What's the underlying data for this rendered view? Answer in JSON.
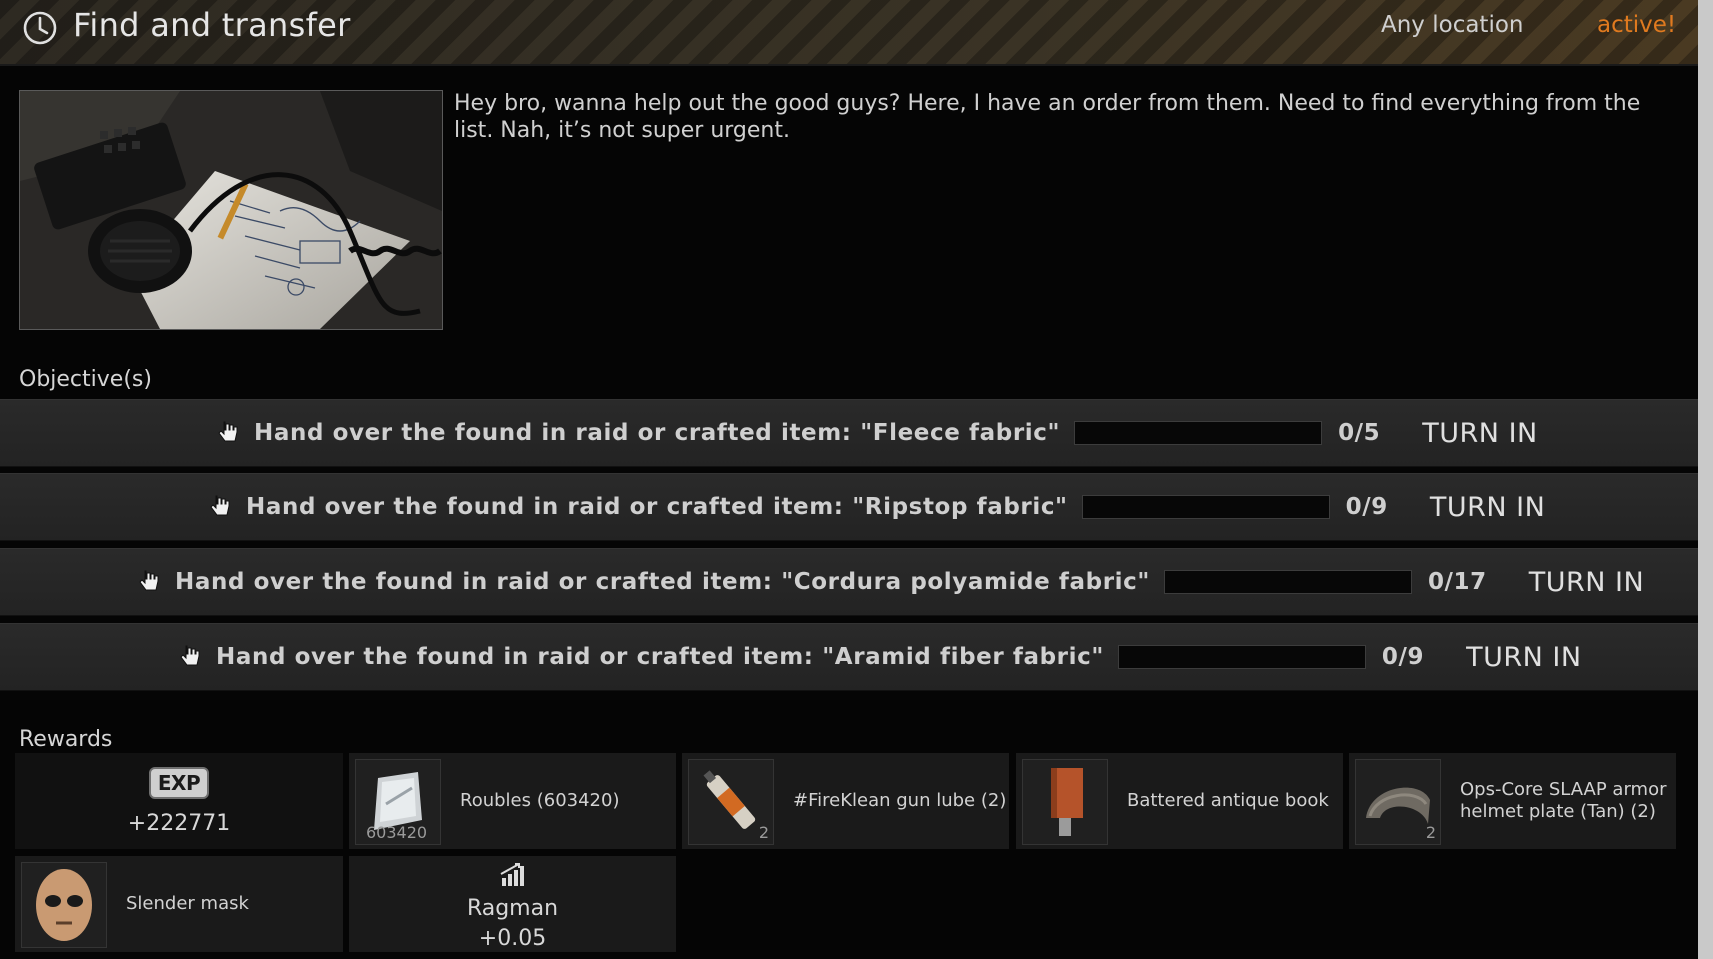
{
  "header": {
    "title": "Find and transfer",
    "location": "Any location",
    "status": "active!",
    "status_color": "#e07a1f",
    "icon": "clock-icon"
  },
  "briefing": {
    "description": "Hey bro, wanna help out the good guys? Here, I have an order from them. Need to find everything from the list. Nah, it’s not super urgent."
  },
  "objectives": {
    "label": "Objective(s)",
    "items": [
      {
        "text": "Hand over the found in raid or crafted item: \"Fleece fabric\"",
        "count": "0/5",
        "progress": 0,
        "button": "TURN IN"
      },
      {
        "text": "Hand over the found in raid or crafted item: \"Ripstop fabric\"",
        "count": "0/9",
        "progress": 0,
        "button": "TURN IN"
      },
      {
        "text": "Hand over the found in raid or crafted item: \"Cordura polyamide fabric\"",
        "count": "0/17",
        "progress": 0,
        "button": "TURN IN"
      },
      {
        "text": "Hand over the found in raid or crafted item: \"Aramid fiber fabric\"",
        "count": "0/9",
        "progress": 0,
        "button": "TURN IN"
      }
    ]
  },
  "rewards": {
    "label": "Rewards",
    "exp": {
      "badge": "EXP",
      "value": "+222771"
    },
    "items": [
      {
        "name": "Roubles (603420)",
        "stack": "603420",
        "icon": "roubles-icon"
      },
      {
        "name": "#FireKlean gun lube (2)",
        "stack": "2",
        "icon": "gun-lube-icon"
      },
      {
        "name": "Battered antique book",
        "stack": "",
        "icon": "book-icon"
      },
      {
        "name": "Ops-Core SLAAP armor helmet plate (Tan) (2)",
        "stack": "2",
        "icon": "helmet-plate-icon"
      },
      {
        "name": "Slender mask",
        "stack": "",
        "icon": "mask-icon"
      }
    ],
    "reputation": {
      "trader": "Ragman",
      "value": "+0.05",
      "icon": "reputation-icon"
    }
  }
}
